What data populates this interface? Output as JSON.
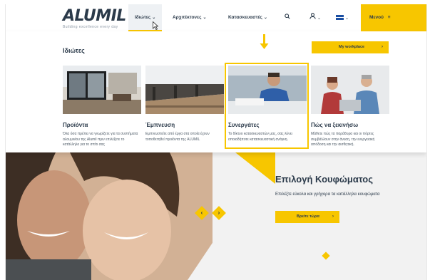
{
  "header": {
    "logo_text": "ALUMIL",
    "logo_tagline": "Building excellence every day",
    "nav": [
      {
        "label": "Ιδιώτες"
      },
      {
        "label": "Αρχιτέκτονες"
      },
      {
        "label": "Κατασκευαστές"
      }
    ],
    "menu_label": "Μενού"
  },
  "mega_menu": {
    "title": "Ιδιώτες",
    "workplace_label": "My workplace",
    "cards": [
      {
        "title": "Προϊόντα",
        "desc": "Όλα όσα πρέπει να γνωρίζετε για τα συστήματα αλουμινίου της Alumil πριν επιλέξετε το κατάλληλο για το σπίτι σας"
      },
      {
        "title": "Έμπνευση",
        "desc": "Εμπνευστείτε από έργα στα οποία έχουν τοποθετηθεί προϊόντα της ALUMIL"
      },
      {
        "title": "Συνεργάτες",
        "desc": "Το δίκτυο κατασκευαστών μας, σας λύνει οποιαδήποτε κατασκευαστική ανάγκη."
      },
      {
        "title": "Πώς να ξεκινήσω",
        "desc": "Μάθετε πώς τα παράθυρα και οι πόρτες συμβάλλουν στην άνεση, την ενεργειακή απόδοση και την αισθητική."
      }
    ]
  },
  "hero": {
    "title": "Επιλογή Κουφώματος",
    "subtitle": "Επιλέξτε εύκολα και γρήγορα τα κατάλληλα κουφώματα",
    "button_label": "Βρείτε τώρα"
  },
  "colors": {
    "accent": "#f7c600",
    "text": "#2b3a4a"
  }
}
